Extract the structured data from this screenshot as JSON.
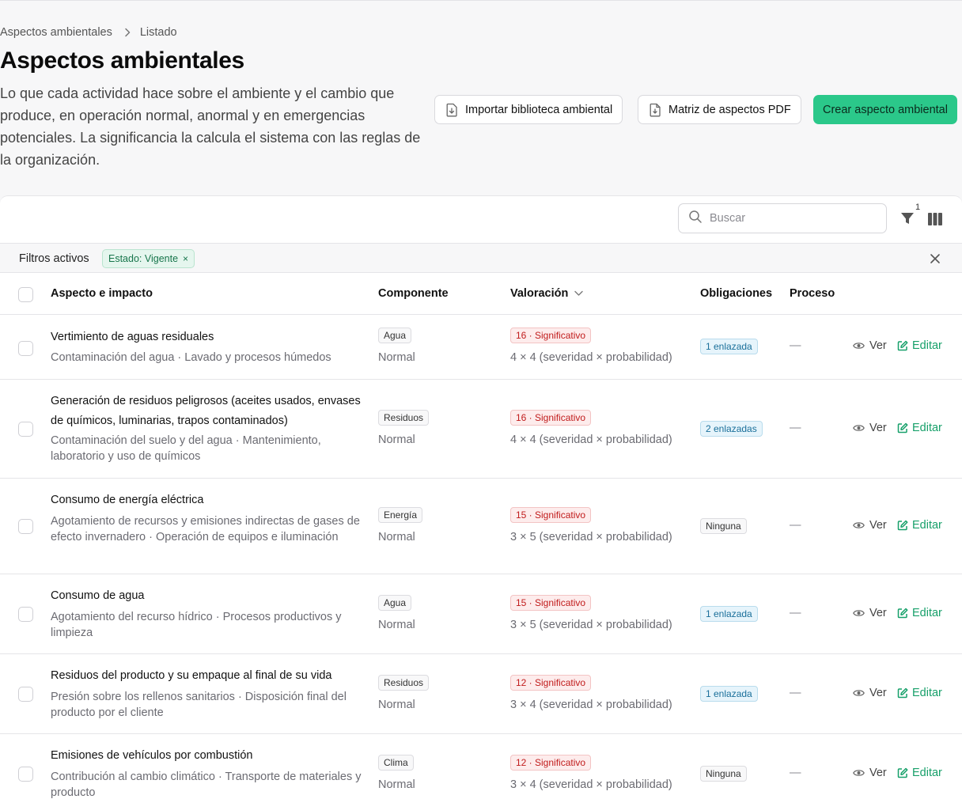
{
  "breadcrumb": {
    "parent": "Aspectos ambientales",
    "current": "Listado"
  },
  "page": {
    "title": "Aspectos ambientales",
    "description": "Lo que cada actividad hace sobre el ambiente y el cambio que produce, en operación normal, anormal y en emergencias potenciales. La significancia la calcula el sistema con las reglas de la organización."
  },
  "actions": {
    "import_label": "Importar biblioteca ambiental",
    "matrix_label": "Matriz de aspectos PDF",
    "create_label": "Crear aspecto ambiental"
  },
  "search": {
    "placeholder": "Buscar"
  },
  "filters": {
    "count": "1",
    "label": "Filtros activos",
    "chip": "Estado: Vigente",
    "chip_remove": "×"
  },
  "table": {
    "headers": {
      "aspect": "Aspecto e impacto",
      "component": "Componente",
      "valuation": "Valoración",
      "obligations": "Obligaciones",
      "process": "Proceso"
    },
    "view_label": "Ver",
    "edit_label": "Editar",
    "rows": [
      {
        "title": "Vertimiento de aguas residuales",
        "subtitle": "Contaminación del agua · Lavado y procesos húmedos",
        "component": "Agua",
        "condition": "Normal",
        "valuation": "16 · Significativo",
        "detail": "4 × 4 (severidad × probabilidad)",
        "obligations": "1 enlazada",
        "process": "—"
      },
      {
        "title": "Generación de residuos peligrosos (aceites usados, envases de químicos, luminarias, trapos contaminados)",
        "subtitle": "Contaminación del suelo y del agua · Mantenimiento, laboratorio y uso de químicos",
        "component": "Residuos",
        "condition": "Normal",
        "valuation": "16 · Significativo",
        "detail": "4 × 4 (severidad × probabilidad)",
        "obligations": "2 enlazadas",
        "process": "—"
      },
      {
        "title": "Consumo de energía eléctrica",
        "subtitle": "Agotamiento de recursos y emisiones indirectas de gases de efecto invernadero · Operación de equipos e iluminación",
        "component": "Energía",
        "condition": "Normal",
        "valuation": "15 · Significativo",
        "detail": "3 × 5 (severidad × probabilidad)",
        "obligations": "Ninguna",
        "process": "—"
      },
      {
        "title": "Consumo de agua",
        "subtitle": "Agotamiento del recurso hídrico · Procesos productivos y limpieza",
        "component": "Agua",
        "condition": "Normal",
        "valuation": "15 · Significativo",
        "detail": "3 × 5 (severidad × probabilidad)",
        "obligations": "1 enlazada",
        "process": "—"
      },
      {
        "title": "Residuos del producto y su empaque al final de su vida",
        "subtitle": "Presión sobre los rellenos sanitarios · Disposición final del producto por el cliente",
        "component": "Residuos",
        "condition": "Normal",
        "valuation": "12 · Significativo",
        "detail": "3 × 4 (severidad × probabilidad)",
        "obligations": "1 enlazada",
        "process": "—"
      },
      {
        "title": "Emisiones de vehículos por combustión",
        "subtitle": "Contribución al cambio climático · Transporte de materiales y producto",
        "component": "Clima",
        "condition": "Normal",
        "valuation": "12 · Significativo",
        "detail": "3 × 4 (severidad × probabilidad)",
        "obligations": "Ninguna",
        "process": "—"
      }
    ]
  },
  "colors": {
    "accent": "#2bc88a",
    "danger": "#c11c1c",
    "link": "#17a06a",
    "info": "#1a6f9a"
  }
}
